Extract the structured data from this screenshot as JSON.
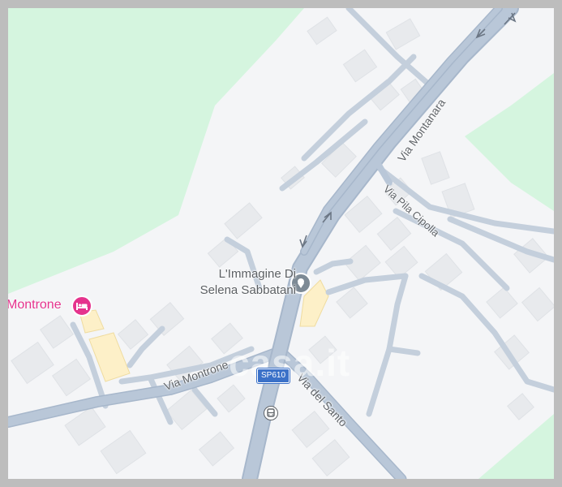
{
  "map": {
    "poi": {
      "name_line1": "L'Immagine Di",
      "name_line2": "Selena Sabbatani",
      "marker_icon": "place-pin-icon"
    },
    "hotel": {
      "name": "Montrone",
      "icon": "hotel-bed-icon",
      "color": "#e5338d"
    },
    "streets": {
      "via_montanara": "Via Montanara",
      "via_pila_cipolla": "Via Pila Cipolla",
      "via_montrone": "Via Montrone",
      "via_del_santo": "Via del Santo"
    },
    "route_shield": "SP610",
    "transit_icon": "bus-stop-icon",
    "watermark": "casa.it",
    "colors": {
      "background": "#f4f5f7",
      "park": "#d5f5df",
      "road": "#b9c7d8",
      "road_edge": "#a7b7cb",
      "building": "#e8eaed",
      "building_yellow": "#fdf0c8",
      "route_shield": "#3b71c8"
    }
  }
}
